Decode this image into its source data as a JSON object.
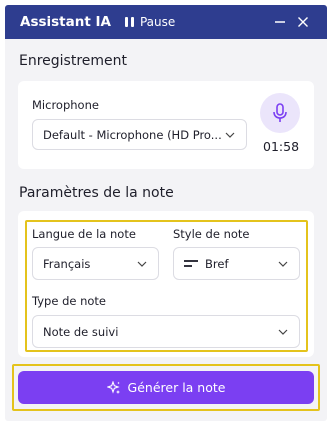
{
  "window": {
    "title": "Assistant IA",
    "pause_label": "Pause",
    "minimize_icon": "minimize-icon",
    "close_icon": "close-icon",
    "titlebar_color": "#2e3d8f"
  },
  "recording": {
    "section_title": "Enregistrement",
    "microphone_label": "Microphone",
    "microphone_value": "Default - Microphone (HD Pro...",
    "mic_icon": "microphone-icon",
    "timer": "01:58"
  },
  "note_settings": {
    "section_title": "Paramètres de la note",
    "language_label": "Langue de la note",
    "language_value": "Français",
    "style_label": "Style de note",
    "style_value": "Bref",
    "style_icon": "short-lines-icon",
    "type_label": "Type de note",
    "type_value": "Note de suivi"
  },
  "actions": {
    "generate_label": "Générer la note",
    "generate_icon": "sparkle-icon",
    "accent_color": "#7b3ff2",
    "highlight_color": "#e4c31c"
  }
}
